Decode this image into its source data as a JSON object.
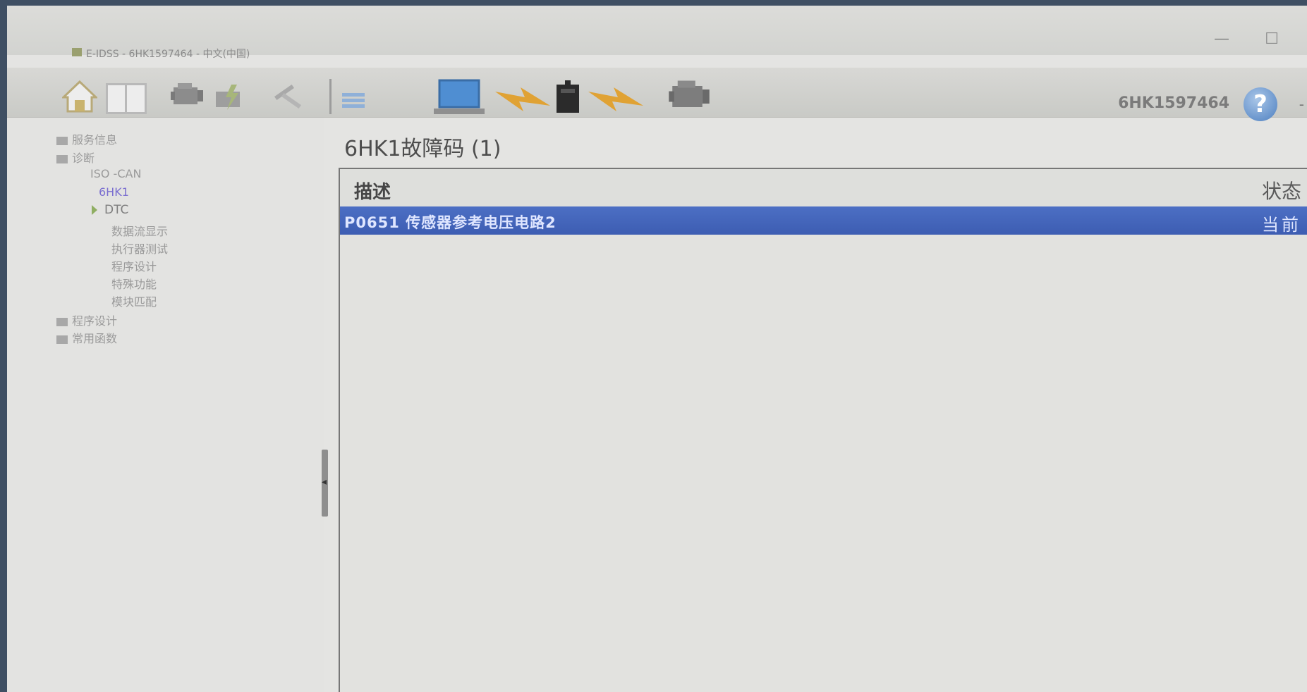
{
  "window": {
    "title": "E-IDSS - 6HK1597464 - 中文(中国)",
    "minimize": "—",
    "maximize": "☐"
  },
  "toolbar": {
    "serial": "6HK1597464",
    "help_label": "?",
    "trailing": "-"
  },
  "sidebar": {
    "items": [
      {
        "label": "服务信息",
        "level": 0
      },
      {
        "label": "诊断",
        "level": 0
      },
      {
        "label": "ISO -CAN",
        "level": 1
      },
      {
        "label": "6HK1",
        "level": 2,
        "selected": true
      },
      {
        "label": "DTC",
        "level": 2,
        "expanded": true
      },
      {
        "label": "数据流显示",
        "level": 3
      },
      {
        "label": "执行器测试",
        "level": 3
      },
      {
        "label": "程序设计",
        "level": 3
      },
      {
        "label": "特殊功能",
        "level": 3
      },
      {
        "label": "模块匹配",
        "level": 3
      },
      {
        "label": "程序设计",
        "level": 0
      },
      {
        "label": "常用函数",
        "level": 0
      }
    ]
  },
  "main": {
    "title": "6HK1故障码 (1)",
    "columns": {
      "description": "描述",
      "status": "状态"
    },
    "rows": [
      {
        "description": "P0651 传感器参考电压电路2",
        "status": "当前"
      }
    ]
  },
  "colors": {
    "selection": "#4466bb",
    "background": "#e3e3e1"
  }
}
